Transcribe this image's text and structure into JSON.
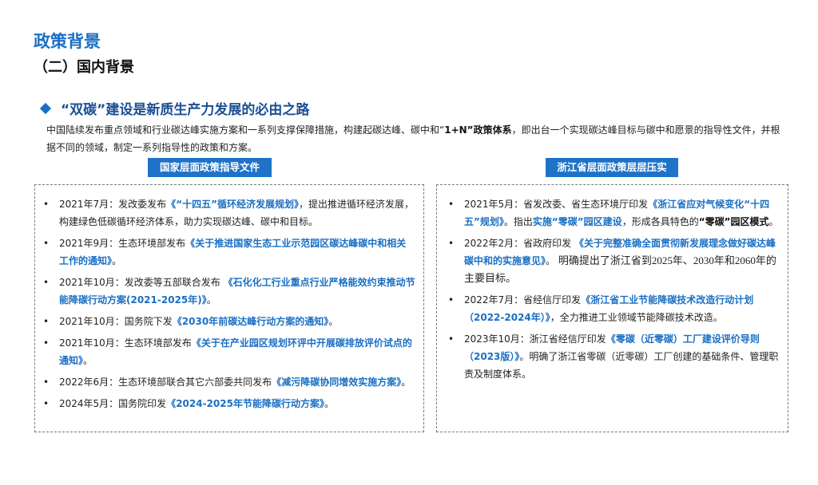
{
  "page": {
    "title": "政策背景",
    "subtitle": "（二）国内背景"
  },
  "section": {
    "heading": "“双碳”建设是新质生产力发展的必由之路",
    "intro_a": "中国陆续发布重点领域和行业碳达峰实施方案和一系列支撑保障措施，构建起碳达峰、碳中和“",
    "intro_b": "1+N”政策体系",
    "intro_c": "，即出台一个实现碳达峰目标与碳中和愿景的指导性文件，并根据不同的领域，制定一系列指导性的政策和方案。"
  },
  "left_panel": {
    "label": "国家层面政策指导文件",
    "items": [
      {
        "pre": "2021年7月：发改委发布",
        "hl": "《“十四五”循环经济发展规划》",
        "post": "，提出推进循环经济发展，构建绿色低碳循环经济体系，助力实现碳达峰、碳中和目标。"
      },
      {
        "pre": "2021年9月：生态环境部发布",
        "hl": "《关于推进国家生态工业示范园区碳达峰碳中和相关工作的通知》",
        "post": "。"
      },
      {
        "pre": "2021年10月：发改委等五部联合发布 ",
        "hl": "《石化化工行业重点行业严格能效约束推动节能降碳行动方案(2021-2025年)》",
        "post": "。"
      },
      {
        "pre": "2021年10月：国务院下发",
        "hl": "《2030年前碳达峰行动方案的通知》",
        "post": "。"
      },
      {
        "pre": "2021年10月：生态环境部发布",
        "hl": "《关于在产业园区规划环评中开展碳排放评价试点的通知》",
        "post": "。"
      },
      {
        "pre": "2022年6月：生态环境部联合其它六部委共同发布",
        "hl": "《减污降碳协同增效实施方案》",
        "post": "。"
      },
      {
        "pre": "2024年5月：国务院印发",
        "hl": "《2024-2025年节能降碳行动方案》",
        "post": "。"
      }
    ]
  },
  "right_panel": {
    "label": "浙江省层面政策层层压实",
    "items": [
      {
        "pre": "2021年5月：省发改委、省生态环境厅印发",
        "hl": "《浙江省应对气候变化“十四五”规划》",
        "mid": "。指出",
        "hl2": "实施“零碳”园区建设",
        "mid2": "，形成各具特色的",
        "bk": "“零碳”园区模式",
        "post": "。"
      },
      {
        "pre": "2022年2月：省政府印发 ",
        "hl": "《关于完整准确全面贯彻新发展理念做好碳达峰碳中和的实施意见》",
        "mid": "。 ",
        "serif": "明确提出了浙江省到2025年、2030年和2060年的主要目标。",
        "post": ""
      },
      {
        "pre": "2022年7月：省经信厅印发",
        "hl": "《浙江省工业节能降碳技术改造行动计划（2022-2024年）》",
        "post": "，全力推进工业领域节能降碳技术改造。"
      },
      {
        "pre": "2023年10月：浙江省经信厅印发",
        "hl": "《零碳（近零碳）工厂建设评价导则（2023版）》",
        "post": "。明确了浙江省零碳（近零碳）工厂创建的基础条件、管理职责及制度体系。"
      }
    ]
  },
  "bullet": "•"
}
